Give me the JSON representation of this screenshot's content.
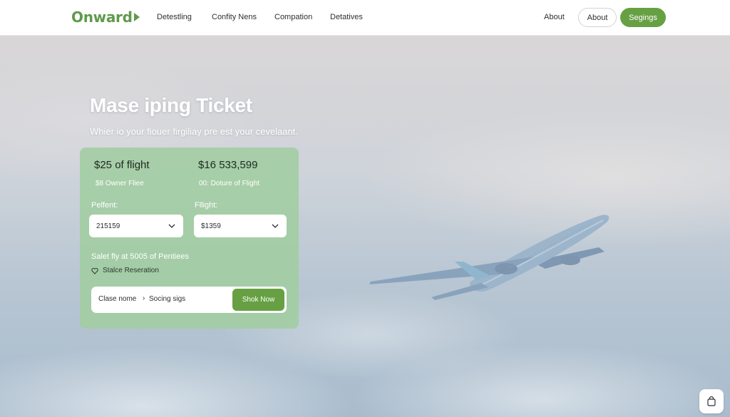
{
  "brand": {
    "logo": "Onward"
  },
  "nav": {
    "links": [
      "Detestling",
      "Confity Nens",
      "Compation",
      "Detatives"
    ],
    "about": "About",
    "about_button": "About",
    "signup_button": "Segings"
  },
  "hero": {
    "title": "Mase iping Ticket",
    "subtitle": "Whier io your fiouer firgiliay pre est your cevelaant."
  },
  "booking": {
    "price_left": "$25 of flight",
    "price_left_note": "$8 Owner Fliee",
    "price_right": "$16 533,599",
    "price_right_note": "00: Doture of Flight",
    "field_left_label": "Pelfent:",
    "field_left_value": "215159",
    "field_right_label": "Fllight:",
    "field_right_value": "$1359",
    "promo": "Salet fly at 5005 of Pentiees",
    "guarantee": "Stalce Reseration",
    "bar_left": "Clase nome",
    "bar_sep": "›",
    "bar_right": "Socing sigs",
    "book_button": "Shok Now"
  },
  "icons": {
    "logo_arrow": "arrow-right-icon",
    "chevron": "chevron-down-icon",
    "guarantee": "heart-shield-icon",
    "corner": "bag-icon",
    "airplane": "airplane-illustration"
  },
  "colors": {
    "brand_green": "#66a043",
    "card_green": "#a0cda0"
  }
}
